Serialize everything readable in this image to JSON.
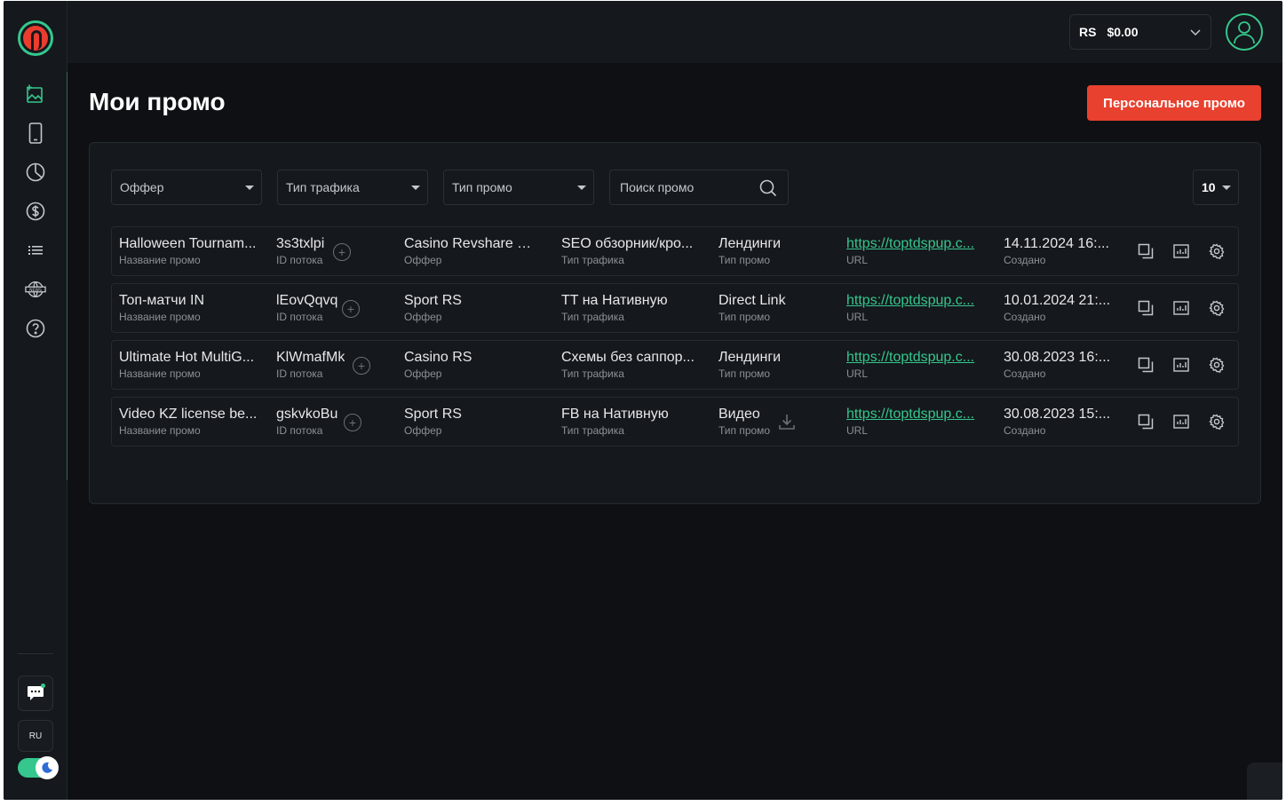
{
  "balance": {
    "currency": "RS",
    "amount": "$0.00"
  },
  "page": {
    "title": "Мои промо",
    "personal_promo_button": "Персональное промо"
  },
  "filters": {
    "offer_placeholder": "Оффер",
    "traffic_type_placeholder": "Тип трафика",
    "promo_type_placeholder": "Тип промо",
    "search_placeholder": "Поиск промо",
    "per_page": "10"
  },
  "sidebar": {
    "items": [
      {
        "icon": "add-image-icon"
      },
      {
        "icon": "mobile-icon"
      },
      {
        "icon": "pie-chart-icon"
      },
      {
        "icon": "dollar-icon"
      },
      {
        "icon": "list-icon"
      },
      {
        "icon": "news-globe-icon"
      },
      {
        "icon": "help-icon"
      }
    ],
    "lang": "RU"
  },
  "labels": {
    "name": "Название промо",
    "stream_id": "ID потока",
    "offer": "Оффер",
    "traffic": "Тип трафика",
    "promo_type": "Тип промо",
    "url": "URL",
    "created": "Создано"
  },
  "rows": [
    {
      "name": "Halloween Tournam...",
      "stream_id": "3s3txlpi",
      "offer": "Casino Revshare U...",
      "traffic": "SEO обзорник/кро...",
      "promo_type": "Лендинги",
      "url": "https://toptdspup.c...",
      "created": "14.11.2024 16:..."
    },
    {
      "name": "Топ-матчи IN",
      "stream_id": "lEovQqvq",
      "offer": "Sport RS",
      "traffic": "TT на Нативную",
      "promo_type": "Direct Link",
      "url": "https://toptdspup.c...",
      "created": "10.01.2024 21:..."
    },
    {
      "name": "Ultimate Hot MultiG...",
      "stream_id": "KlWmafMk",
      "offer": "Casino RS",
      "traffic": "Схемы без саппор...",
      "promo_type": "Лендинги",
      "url": "https://toptdspup.c...",
      "created": "30.08.2023 16:..."
    },
    {
      "name": "Video KZ license be...",
      "stream_id": "gskvkoBu",
      "offer": "Sport RS",
      "traffic": "FB на Нативную",
      "promo_type": "Видео",
      "url": "https://toptdspup.c...",
      "created": "30.08.2023 15:..."
    }
  ],
  "colors": {
    "accent": "#35c78d",
    "brand_red": "#e8412f",
    "background": "#0e1013",
    "surface": "#15181c"
  }
}
